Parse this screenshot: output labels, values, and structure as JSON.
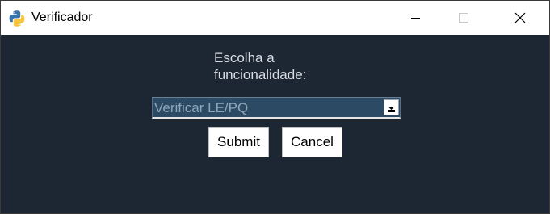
{
  "window": {
    "title": "Verificador",
    "controls": {
      "minimize_icon": "minimize-icon",
      "maximize_icon": "maximize-icon",
      "close_icon": "close-icon"
    }
  },
  "dialog": {
    "prompt": "Escolha a funcionalidade:",
    "select": {
      "value": "Verificar LE/PQ",
      "dropdown_icon": "chevron-down-icon"
    },
    "submit_label": "Submit",
    "cancel_label": "Cancel"
  },
  "colors": {
    "background": "#1d2733",
    "select_background": "#2c4a63",
    "select_text": "#8fa6ba",
    "label_text": "#d8dde3"
  }
}
